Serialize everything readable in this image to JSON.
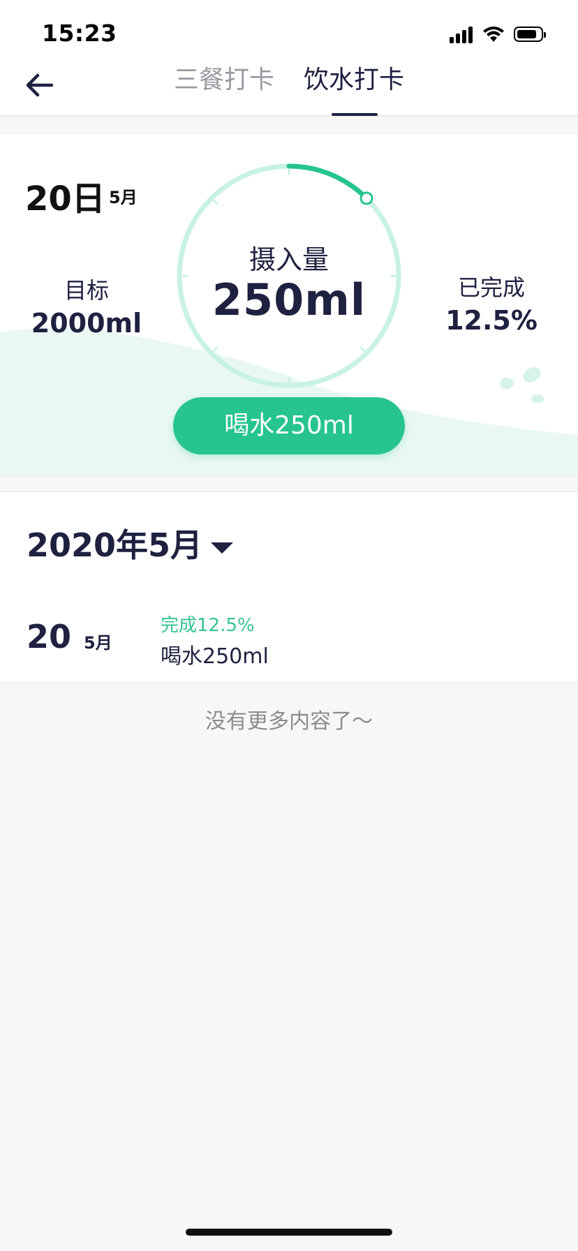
{
  "status_bar": {
    "time": "15:23",
    "icons": [
      "signal-icon",
      "wifi-icon",
      "battery-icon"
    ]
  },
  "nav": {
    "back_icon": "arrow-left-icon",
    "tabs": [
      {
        "label": "三餐打卡",
        "active": false
      },
      {
        "label": "饮水打卡",
        "active": true
      }
    ]
  },
  "water_card": {
    "date_day": "20日",
    "date_month": "5月",
    "target_label": "目标",
    "target_value": "2000ml",
    "intake_label": "摄入量",
    "intake_value": "250ml",
    "done_label": "已完成",
    "done_value": "12.5%",
    "progress_fraction": 0.125,
    "drink_button": "喝水250ml"
  },
  "history": {
    "month_picker": "2020年5月",
    "records": [
      {
        "day": "20",
        "month": "5月",
        "status": "完成12.5%",
        "detail": "喝水250ml"
      }
    ]
  },
  "end_note": "没有更多内容了～",
  "colors": {
    "accent": "#27c48e",
    "ring_track": "#c8f2e2",
    "text_primary": "#1e2140",
    "text_muted": "#9a9aa3"
  }
}
